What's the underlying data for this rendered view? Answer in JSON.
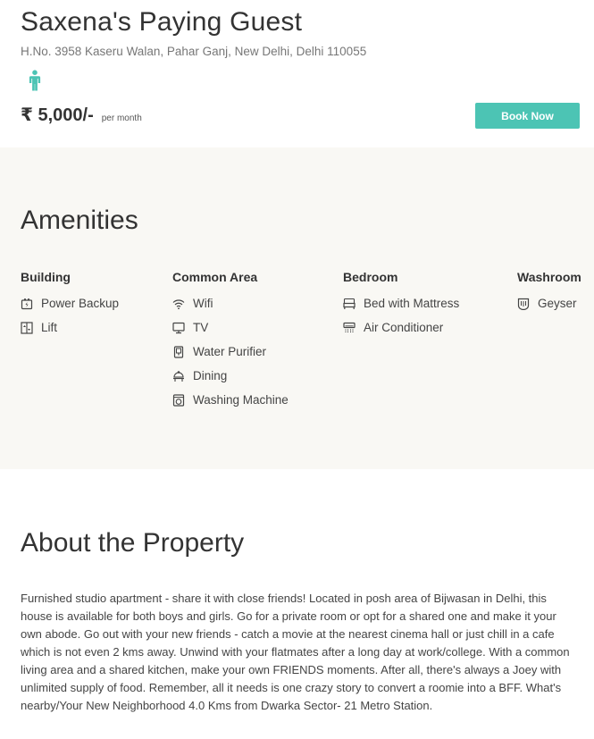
{
  "property": {
    "title": "Saxena's Paying Guest",
    "address": "H.No. 3958 Kaseru Walan, Pahar Ganj, New Delhi, Delhi 110055",
    "gender_icon": "male-person-icon",
    "price": "₹ 5,000/-",
    "price_period": "per month",
    "book_label": "Book Now"
  },
  "colors": {
    "accent": "#4cc4b4",
    "amenities_bg": "#f9f8f4",
    "text": "#333333"
  },
  "amenities": {
    "title": "Amenities",
    "groups": [
      {
        "title": "Building",
        "items": [
          {
            "label": "Power Backup",
            "icon": "power-backup-icon"
          },
          {
            "label": "Lift",
            "icon": "lift-icon"
          }
        ]
      },
      {
        "title": "Common Area",
        "items": [
          {
            "label": "Wifi",
            "icon": "wifi-icon"
          },
          {
            "label": "TV",
            "icon": "tv-icon"
          },
          {
            "label": "Water Purifier",
            "icon": "water-purifier-icon"
          },
          {
            "label": "Dining",
            "icon": "dining-icon"
          },
          {
            "label": "Washing Machine",
            "icon": "washing-machine-icon"
          }
        ]
      },
      {
        "title": "Bedroom",
        "items": [
          {
            "label": "Bed with Mattress",
            "icon": "bed-icon"
          },
          {
            "label": "Air Conditioner",
            "icon": "air-conditioner-icon"
          }
        ]
      },
      {
        "title": "Washroom",
        "items": [
          {
            "label": "Geyser",
            "icon": "geyser-icon"
          }
        ]
      }
    ]
  },
  "about": {
    "title": "About the Property",
    "description": "Furnished studio apartment - share it with close friends! Located in posh area of Bijwasan in Delhi, this house is available for both boys and girls. Go for a private room or opt for a shared one and make it your own abode. Go out with your new friends - catch a movie at the nearest cinema hall or just chill in a cafe which is not even 2 kms away. Unwind with your flatmates after a long day at work/college. With a common living area and a shared kitchen, make your own FRIENDS moments. After all, there's always a Joey with unlimited supply of food. Remember, all it needs is one crazy story to convert a roomie into a BFF. What's nearby/Your New Neighborhood 4.0 Kms from Dwarka Sector- 21 Metro Station."
  }
}
